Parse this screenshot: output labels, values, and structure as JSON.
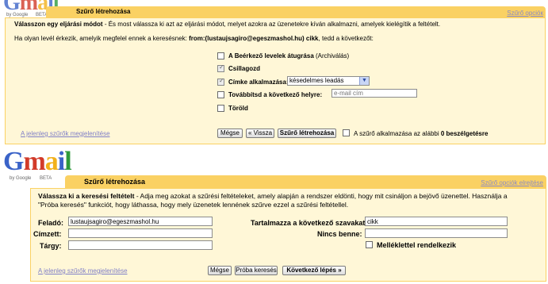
{
  "top": {
    "logo_text": "Gmail",
    "logo_sub": "by Google",
    "logo_beta": "BETA",
    "title": "Szűrő létrehozása",
    "right_link": "Szűrő opcióк",
    "intro_bold": "Válasszon egy eljárási módot",
    "intro_rest": " - És most válassza ki azt az eljárási módot, melyet azokra az üzenetekre kíván alkalmazni, amelyek kielégítik a feltételt.",
    "criteria_prefix": "Ha olyan levél érkezik, amelyik megfelel ennek a keresésnek: ",
    "criteria_value": "from:(lustaujsagiro@egeszmashol.hu) cikk",
    "criteria_suffix": ", tedd a következőt:",
    "actions": [
      {
        "label": "A Beérkező levelek átugrása",
        "note": " (Archiválás)",
        "checked": false
      },
      {
        "label": "Csillagozd",
        "note": "",
        "checked": true
      },
      {
        "label": "Címke alkalmazása:",
        "note": "",
        "checked": true
      },
      {
        "label": "Továbbítsd a következő helyre:",
        "note": "",
        "checked": false
      },
      {
        "label": "Töröld",
        "note": "",
        "checked": false
      }
    ],
    "label_select_value": "késedelmes leadás",
    "forward_placeholder": "e-mail cím",
    "show_filters_link": "A jelenleg szűrők megjelenítése",
    "buttons": {
      "cancel": "Mégse",
      "back": "« Vissza",
      "create": "Szűrő létrehozása"
    },
    "apply_checkbox_text": "A szűrő alkalmazása az alábbi ",
    "apply_count": "0",
    "apply_checkbox_bold": " beszélgetésre"
  },
  "bottom": {
    "logo_text": "Gmail",
    "logo_sub": "by Google",
    "logo_beta": "BETA",
    "title": "Szűrő létrehozása",
    "right_link": "Szűrő opciók elrejtése",
    "intro_bold": "Válassza ki a keresési feltételt",
    "intro_rest": " - Adja meg azokat a szűrési feltételeket, amely alapján a rendszer eldönti, hogy mit csináljon a bejövő üzenettel. Használja a",
    "intro_line2": "\"Próba keresés\" funkciót, hogy láthassa, hogy mely üzenetek lennének szűrve ezzel a szűrési feltétellel.",
    "fields": {
      "from_label": "Feladó:",
      "from_value": "lustaujsagiro@egeszmashol.hu",
      "to_label": "Címzett:",
      "to_value": "",
      "subject_label": "Tárgy:",
      "subject_value": "",
      "has_words_label": "Tartalmazza a következő szavakat:",
      "has_words_value": "cikk",
      "doesnt_have_label": "Nincs benne:",
      "doesnt_have_value": ""
    },
    "has_attachment_label": "Melléklettel rendelkezik",
    "show_filters_link": "A jelenleg szűrők megjelenítése",
    "buttons": {
      "cancel": "Mégse",
      "test_search": "Próba keresés",
      "next_step": "Következő lépés »"
    }
  },
  "colors": {
    "title_bar": "#fad163",
    "box_bg": "#fff7d7",
    "link": "#7f7fc7"
  }
}
